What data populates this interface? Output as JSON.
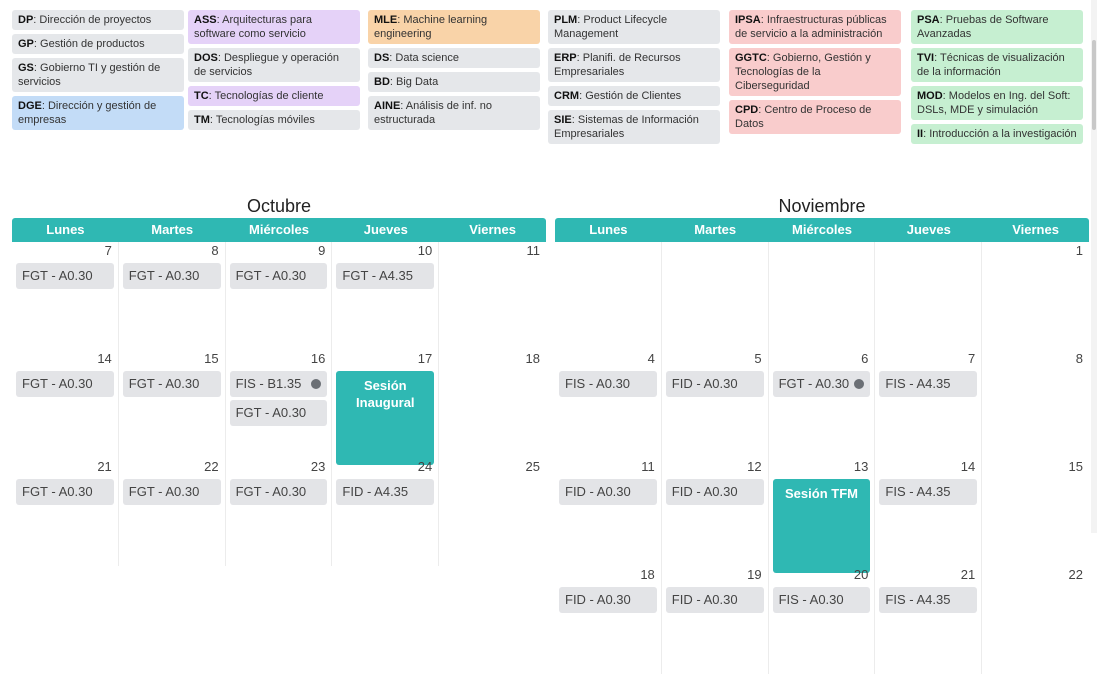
{
  "legend": {
    "col1": [
      {
        "code": "DP",
        "name": "Dirección de proyectos",
        "color": "gray"
      },
      {
        "code": "GP",
        "name": "Gestión de productos",
        "color": "gray"
      },
      {
        "code": "GS",
        "name": "Gobierno TI y gestión de servicios",
        "color": "gray"
      },
      {
        "code": "DGE",
        "name": "Dirección y gestión de empresas",
        "color": "blue"
      }
    ],
    "col2": [
      {
        "code": "ASS",
        "name": "Arquitecturas para software como servicio",
        "color": "purple"
      },
      {
        "code": "DOS",
        "name": "Despliegue y operación de servicios",
        "color": "gray"
      },
      {
        "code": "TC",
        "name": "Tecnologías de cliente",
        "color": "purple"
      },
      {
        "code": "TM",
        "name": "Tecnologías móviles",
        "color": "gray"
      }
    ],
    "col3": [
      {
        "code": "MLE",
        "name": "Machine learning engineering",
        "color": "orange"
      },
      {
        "code": "DS",
        "name": "Data science",
        "color": "gray"
      },
      {
        "code": "BD",
        "name": "Big Data",
        "color": "gray"
      },
      {
        "code": "AINE",
        "name": "Análisis de inf. no estructurada",
        "color": "gray"
      }
    ],
    "col4": [
      {
        "code": "PLM",
        "name": "Product Lifecycle Management",
        "color": "gray"
      },
      {
        "code": "ERP",
        "name": "Planifi. de Recursos Empresariales",
        "color": "gray"
      },
      {
        "code": "CRM",
        "name": "Gestión de Clientes",
        "color": "gray"
      },
      {
        "code": "SIE",
        "name": "Sistemas de Información Empresariales",
        "color": "gray"
      }
    ],
    "col5": [
      {
        "code": "IPSA",
        "name": "Infraestructuras públicas de servicio a la administración",
        "color": "pink"
      },
      {
        "code": "GGTC",
        "name": "Gobierno, Gestión y Tecnologías de la Ciberseguridad",
        "color": "pink"
      },
      {
        "code": "CPD",
        "name": "Centro de Proceso de Datos",
        "color": "pink"
      }
    ],
    "col6": [
      {
        "code": "PSA",
        "name": "Pruebas de Software Avanzadas",
        "color": "green"
      },
      {
        "code": "TVI",
        "name": "Técnicas de visualización de la información",
        "color": "green"
      },
      {
        "code": "MOD",
        "name": "Modelos en Ing. del Soft: DSLs, MDE y simulación",
        "color": "green"
      },
      {
        "code": "II",
        "name": "Introducción a la investigación",
        "color": "green"
      }
    ]
  },
  "colors": {
    "gray": "#e5e7ea",
    "blue": "#c3dcf7",
    "purple": "#e5d2f8",
    "orange": "#f9d3a8",
    "pink": "#f9cccc",
    "green": "#c6efd1",
    "accent": "#2fb8b3"
  },
  "weekdays": [
    "Lunes",
    "Martes",
    "Miércoles",
    "Jueves",
    "Viernes"
  ],
  "calendars": [
    {
      "title": "Octubre",
      "weeks": [
        [
          {
            "day": "7",
            "events": [
              {
                "label": "FGT - A0.30"
              }
            ]
          },
          {
            "day": "8",
            "events": [
              {
                "label": "FGT - A0.30"
              }
            ]
          },
          {
            "day": "9",
            "events": [
              {
                "label": "FGT - A0.30"
              }
            ]
          },
          {
            "day": "10",
            "events": [
              {
                "label": "FGT - A4.35"
              }
            ]
          },
          {
            "day": "11",
            "events": []
          }
        ],
        [
          {
            "day": "14",
            "events": [
              {
                "label": "FGT - A0.30"
              }
            ]
          },
          {
            "day": "15",
            "events": [
              {
                "label": "FGT - A0.30"
              }
            ]
          },
          {
            "day": "16",
            "events": [
              {
                "label": "FIS - B1.35",
                "dot": true
              },
              {
                "label": "FGT - A0.30"
              }
            ]
          },
          {
            "day": "17",
            "special": "Sesión Inaugural"
          },
          {
            "day": "18",
            "events": []
          }
        ],
        [
          {
            "day": "21",
            "events": [
              {
                "label": "FGT - A0.30"
              }
            ]
          },
          {
            "day": "22",
            "events": [
              {
                "label": "FGT - A0.30"
              }
            ]
          },
          {
            "day": "23",
            "events": [
              {
                "label": "FGT - A0.30"
              }
            ]
          },
          {
            "day": "24",
            "events": [
              {
                "label": "FID - A4.35"
              }
            ]
          },
          {
            "day": "25",
            "events": []
          }
        ]
      ]
    },
    {
      "title": "Noviembre",
      "weeks": [
        [
          {
            "day": "",
            "events": []
          },
          {
            "day": "",
            "events": []
          },
          {
            "day": "",
            "events": []
          },
          {
            "day": "",
            "events": []
          },
          {
            "day": "1",
            "events": []
          }
        ],
        [
          {
            "day": "4",
            "events": [
              {
                "label": "FIS - A0.30"
              }
            ]
          },
          {
            "day": "5",
            "events": [
              {
                "label": "FID - A0.30"
              }
            ]
          },
          {
            "day": "6",
            "events": [
              {
                "label": "FGT - A0.30",
                "dot": true
              }
            ]
          },
          {
            "day": "7",
            "events": [
              {
                "label": "FIS - A4.35"
              }
            ]
          },
          {
            "day": "8",
            "events": []
          }
        ],
        [
          {
            "day": "11",
            "events": [
              {
                "label": "FID - A0.30"
              }
            ]
          },
          {
            "day": "12",
            "events": [
              {
                "label": "FID - A0.30"
              }
            ]
          },
          {
            "day": "13",
            "special": "Sesión TFM"
          },
          {
            "day": "14",
            "events": [
              {
                "label": "FIS - A4.35"
              }
            ]
          },
          {
            "day": "15",
            "events": []
          }
        ],
        [
          {
            "day": "18",
            "events": [
              {
                "label": "FID - A0.30"
              }
            ]
          },
          {
            "day": "19",
            "events": [
              {
                "label": "FID - A0.30"
              }
            ]
          },
          {
            "day": "20",
            "events": [
              {
                "label": "FIS - A0.30"
              }
            ]
          },
          {
            "day": "21",
            "events": [
              {
                "label": "FIS - A4.35"
              }
            ]
          },
          {
            "day": "22",
            "events": []
          }
        ]
      ]
    }
  ]
}
